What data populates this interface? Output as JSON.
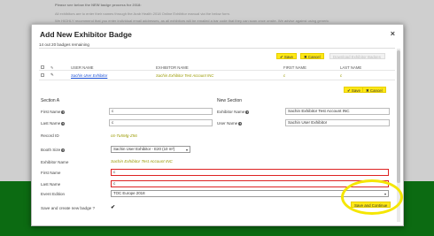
{
  "background": {
    "line1": "Please see below the NEW badge process for 2018:",
    "line2": "All exhibitors are to enter their names through the Arab Health 2018 Online Exhibitor manual via the below form.",
    "line3": "We HIGHLY recommend that you enter individual email addresses, as all exhibitors will be emailed a bar code that they can scan once onsite.  We advise against using generic"
  },
  "modal": {
    "title": "Add New Exhibitor Badge",
    "close": "×",
    "remaining": "14 out 20 badges remaining"
  },
  "toolbar": {
    "save_label": "Save",
    "cancel_label": "Cancel",
    "disabled_label": "Download Exhibitor Badges"
  },
  "table": {
    "headers": [
      "USER NAME",
      "EXHIBITOR NAME",
      "FIRST NAME",
      "LAST NAME"
    ],
    "row": {
      "user_name": "Sachin User Exhibitor",
      "exhibitor_name": "Sachin Exhibitor Test Account INC",
      "first_name": "c",
      "last_name": "c"
    }
  },
  "section_a": {
    "title": "Section A",
    "first_name_label": "First Name",
    "first_name_value": "c",
    "last_name_label": "Last Name",
    "last_name_value": "c",
    "record_id_label": "Record ID",
    "record_id_value": "c6-Tu5Mg-Z56"
  },
  "new_section": {
    "title": "New Section",
    "exhibitor_name_label": "Exhibitor Name",
    "exhibitor_name_value": "Sachin Exhibitor Test Account INC",
    "user_name_label": "User Name",
    "user_name_value": "Sachin User Exhibitor"
  },
  "form": {
    "booth_size_label": "Booth Size",
    "booth_size_value": "Sachin User Exhibitor - E20 (10 m²)",
    "exhibitor_name_label": "Exhibitor Name",
    "exhibitor_name_value": "Sachin Exhibitor Test Account INC",
    "first_name_label": "First Name",
    "first_name_value": "c",
    "last_name_label": "Last Name",
    "last_name_value": "c",
    "event_edition_label": "Event Edition",
    "event_edition_value": "TOC Europe 2018",
    "save_new_label": "Save and create new badge ?",
    "save_continue_label": "Save and Continue"
  },
  "icons": {
    "check": "✔",
    "pencil": "✎",
    "save": "✔",
    "cancel": "✖",
    "help": "?",
    "dropdown": "▾"
  },
  "colors": {
    "accent_yellow": "#ffe815",
    "link_blue": "#1a4fd6",
    "olive": "#9a9a00",
    "error_red": "#d22222",
    "footer_green": "#0c6b12"
  }
}
